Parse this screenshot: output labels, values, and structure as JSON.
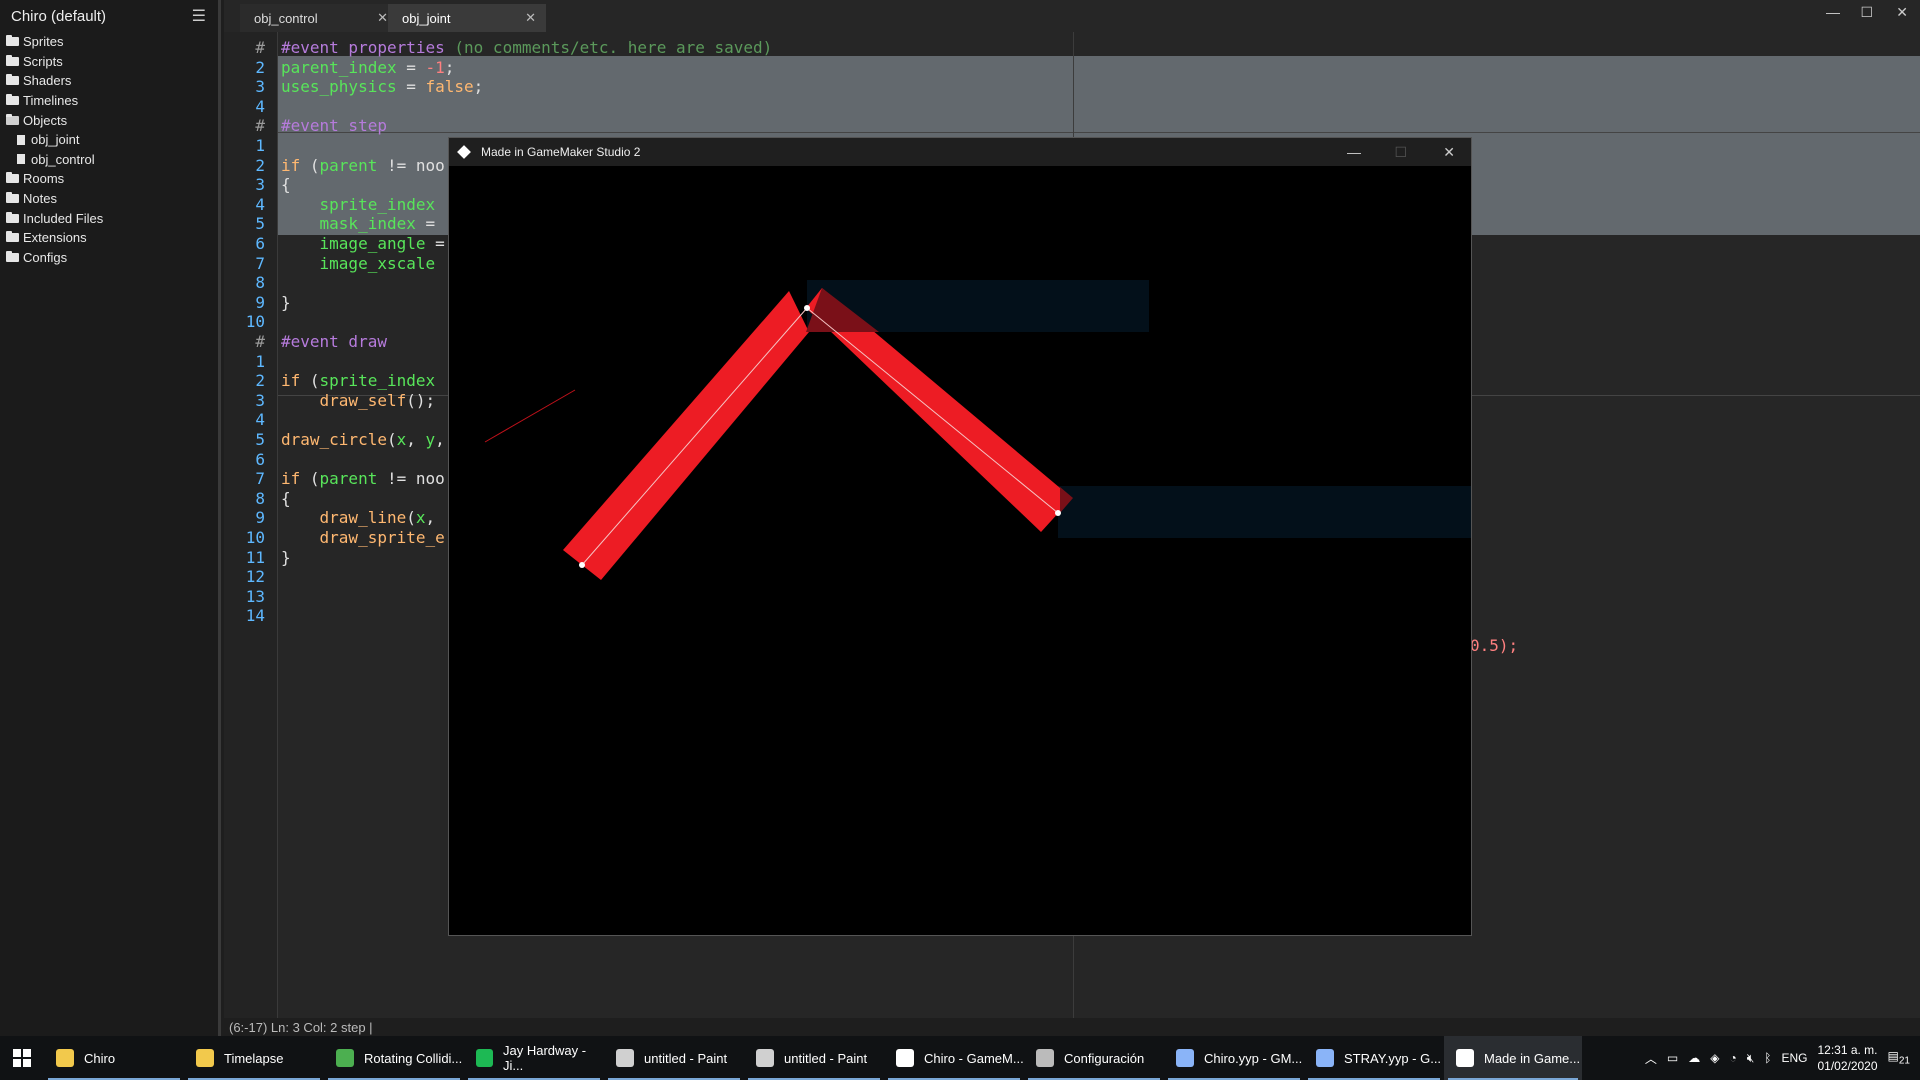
{
  "sidebar": {
    "title": "Chiro (default)",
    "items": [
      {
        "label": "Sprites"
      },
      {
        "label": "Scripts"
      },
      {
        "label": "Shaders"
      },
      {
        "label": "Timelines"
      },
      {
        "label": "Objects"
      },
      {
        "label": "obj_joint"
      },
      {
        "label": "obj_control"
      },
      {
        "label": "Rooms"
      },
      {
        "label": "Notes"
      },
      {
        "label": "Included Files"
      },
      {
        "label": "Extensions"
      },
      {
        "label": "Configs"
      }
    ]
  },
  "tabs": [
    {
      "label": "obj_control"
    },
    {
      "label": "obj_joint"
    }
  ],
  "code": {
    "lines": [
      {
        "n": "#",
        "t": "#event properties (no comments/etc. here are saved)"
      },
      {
        "n": "2",
        "t": "parent_index = -1;"
      },
      {
        "n": "3",
        "t": "uses_physics = false;"
      },
      {
        "n": "4",
        "t": ""
      },
      {
        "n": "#",
        "t": "#event step"
      },
      {
        "n": "1",
        "t": ""
      },
      {
        "n": "2",
        "t": "if (parent != noo"
      },
      {
        "n": "3",
        "t": "{"
      },
      {
        "n": "4",
        "t": "    sprite_index"
      },
      {
        "n": "5",
        "t": "    mask_index ="
      },
      {
        "n": "6",
        "t": "    image_angle ="
      },
      {
        "n": "7",
        "t": "    image_xscale"
      },
      {
        "n": "8",
        "t": ""
      },
      {
        "n": "9",
        "t": "}"
      },
      {
        "n": "10",
        "t": ""
      },
      {
        "n": "#",
        "t": "#event draw"
      },
      {
        "n": "1",
        "t": ""
      },
      {
        "n": "2",
        "t": "if (sprite_index"
      },
      {
        "n": "3",
        "t": "    draw_self();"
      },
      {
        "n": "4",
        "t": ""
      },
      {
        "n": "5",
        "t": "draw_circle(x, y,"
      },
      {
        "n": "6",
        "t": ""
      },
      {
        "n": "7",
        "t": "if (parent != noo"
      },
      {
        "n": "8",
        "t": "{"
      },
      {
        "n": "9",
        "t": "    draw_line(x,"
      },
      {
        "n": "10",
        "t": "    draw_sprite_e"
      },
      {
        "n": "11",
        "t": "}"
      },
      {
        "n": "12",
        "t": ""
      },
      {
        "n": "13",
        "t": ""
      },
      {
        "n": "14",
        "t": ""
      }
    ],
    "overflow_fragment": "0.5);"
  },
  "status": {
    "text": "(6:-17) Ln:   3 Col:   2  step |"
  },
  "game_window": {
    "title": "Made in GameMaker Studio 2"
  },
  "taskbar": {
    "items": [
      {
        "label": "Chiro",
        "color": "#f2c94c"
      },
      {
        "label": "Timelapse",
        "color": "#f2c94c"
      },
      {
        "label": "Rotating Collidi...",
        "color": "#4caf50"
      },
      {
        "label": "Jay Hardway - Ji...",
        "color": "#1db954"
      },
      {
        "label": "untitled - Paint",
        "color": "#d0d0d0"
      },
      {
        "label": "untitled - Paint",
        "color": "#d0d0d0"
      },
      {
        "label": "Chiro - GameM...",
        "color": "#ffffff"
      },
      {
        "label": "Configuración",
        "color": "#bbbbbb"
      },
      {
        "label": "Chiro.yyp - GM...",
        "color": "#8ab4f8"
      },
      {
        "label": "STRAY.yyp - G...",
        "color": "#8ab4f8"
      },
      {
        "label": "Made in Game...",
        "color": "#ffffff"
      }
    ],
    "tray": {
      "lang": "ENG",
      "time": "12:31 a. m.",
      "date": "01/02/2020",
      "notifications": "21"
    }
  }
}
